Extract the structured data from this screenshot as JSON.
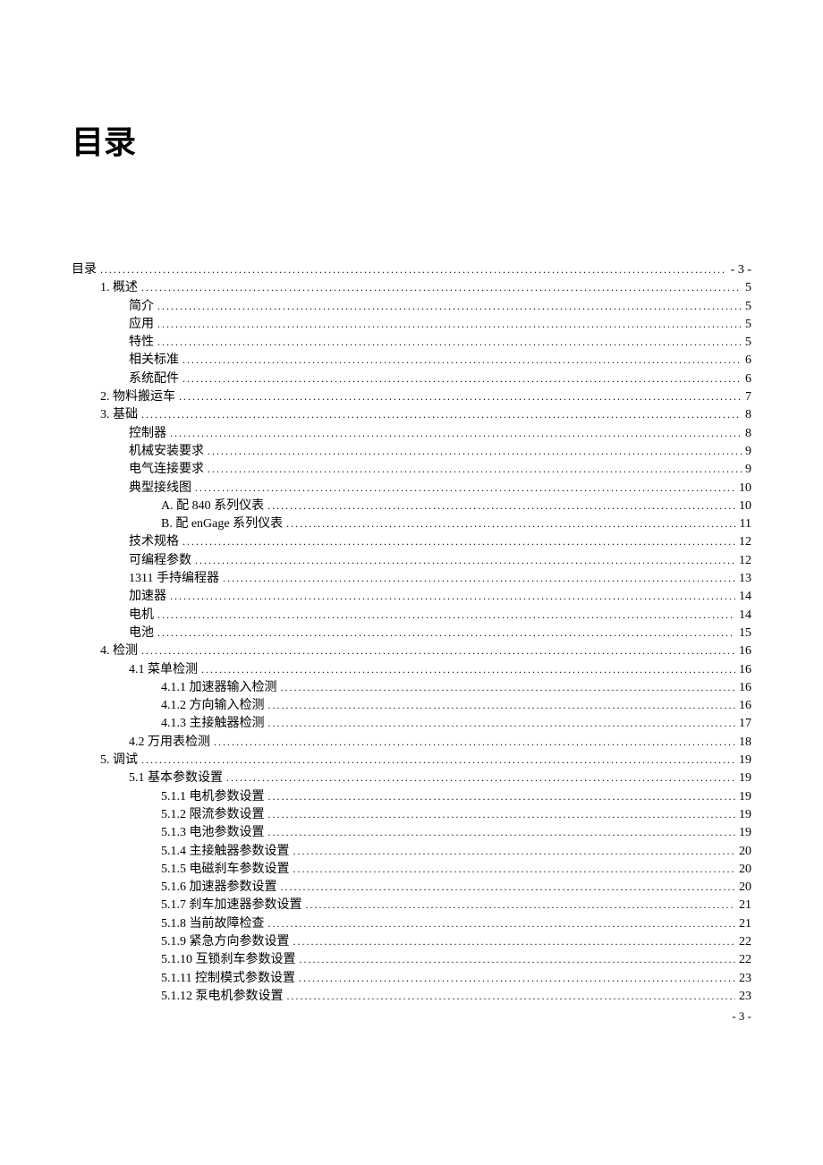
{
  "title": "目录",
  "page_number": "- 3 -",
  "toc": [
    {
      "label": "目录",
      "page": "- 3 -",
      "indent": 0
    },
    {
      "label": "1.  概述",
      "page": "5",
      "indent": 1
    },
    {
      "label": "简介",
      "page": "5",
      "indent": 2
    },
    {
      "label": "应用",
      "page": "5",
      "indent": 2
    },
    {
      "label": "特性",
      "page": "5",
      "indent": 2
    },
    {
      "label": "相关标准",
      "page": "6",
      "indent": 2
    },
    {
      "label": "系统配件",
      "page": "6",
      "indent": 2
    },
    {
      "label": "2.  物料搬运车",
      "page": "7",
      "indent": 1
    },
    {
      "label": "3.  基础",
      "page": "8",
      "indent": 1
    },
    {
      "label": "控制器",
      "page": "8",
      "indent": 2
    },
    {
      "label": "机械安装要求",
      "page": "9",
      "indent": 2
    },
    {
      "label": "电气连接要求",
      "page": "9",
      "indent": 2
    },
    {
      "label": "典型接线图",
      "page": "10",
      "indent": 2
    },
    {
      "label": "A.  配 840 系列仪表",
      "page": "10",
      "indent": 3
    },
    {
      "label": "B.  配 enGage 系列仪表",
      "page": "11",
      "indent": 3
    },
    {
      "label": "技术规格",
      "page": "12",
      "indent": 2
    },
    {
      "label": "可编程参数",
      "page": "12",
      "indent": 2
    },
    {
      "label": "1311 手持编程器",
      "page": "13",
      "indent": 2
    },
    {
      "label": "加速器",
      "page": "14",
      "indent": 2
    },
    {
      "label": "电机",
      "page": "14",
      "indent": 2
    },
    {
      "label": "电池",
      "page": "15",
      "indent": 2
    },
    {
      "label": "4.  检测",
      "page": "16",
      "indent": 1
    },
    {
      "label": "4.1 菜单检测",
      "page": "16",
      "indent": 2
    },
    {
      "label": "4.1.1 加速器输入检测",
      "page": "16",
      "indent": 3
    },
    {
      "label": "4.1.2 方向输入检测",
      "page": "16",
      "indent": 3
    },
    {
      "label": "4.1.3 主接触器检测",
      "page": "17",
      "indent": 3
    },
    {
      "label": "4.2 万用表检测",
      "page": "18",
      "indent": 2
    },
    {
      "label": "5.  调试",
      "page": "19",
      "indent": 1
    },
    {
      "label": "5.1 基本参数设置",
      "page": "19",
      "indent": 2
    },
    {
      "label": "5.1.1 电机参数设置",
      "page": "19",
      "indent": 3
    },
    {
      "label": "5.1.2 限流参数设置",
      "page": "19",
      "indent": 3
    },
    {
      "label": "5.1.3 电池参数设置",
      "page": "19",
      "indent": 3
    },
    {
      "label": "5.1.4 主接触器参数设置",
      "page": "20",
      "indent": 3
    },
    {
      "label": "5.1.5 电磁刹车参数设置",
      "page": "20",
      "indent": 3
    },
    {
      "label": "5.1.6 加速器参数设置",
      "page": "20",
      "indent": 3
    },
    {
      "label": "5.1.7 刹车加速器参数设置",
      "page": "21",
      "indent": 3
    },
    {
      "label": "5.1.8 当前故障检查",
      "page": "21",
      "indent": 3
    },
    {
      "label": "5.1.9 紧急方向参数设置",
      "page": "22",
      "indent": 3
    },
    {
      "label": "5.1.10 互锁刹车参数设置",
      "page": "22",
      "indent": 3
    },
    {
      "label": "5.1.11 控制模式参数设置",
      "page": "23",
      "indent": 3
    },
    {
      "label": "5.1.12 泵电机参数设置",
      "page": "23",
      "indent": 3
    }
  ]
}
